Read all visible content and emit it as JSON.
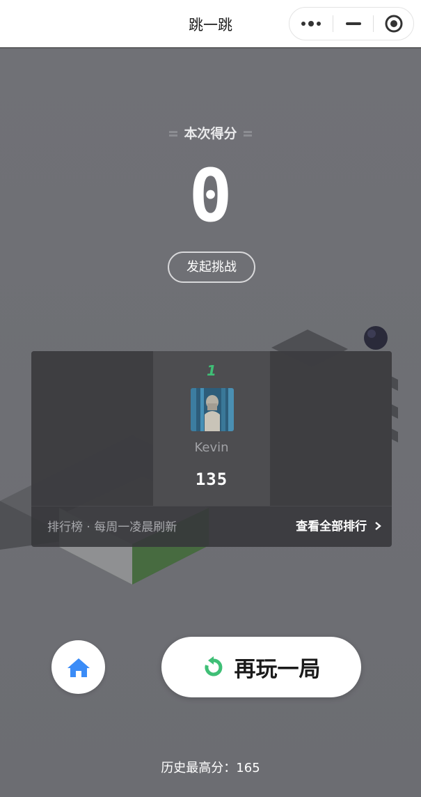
{
  "window": {
    "title": "跳一跳"
  },
  "capsule": {
    "menu_icon": "more-dots-icon",
    "minimize_icon": "minus-icon",
    "close_icon": "target-circle-icon"
  },
  "result": {
    "score_label": "本次得分",
    "score": "0",
    "challenge_label": "发起挑战"
  },
  "leaderboard": {
    "entries": [
      {
        "rank": "1",
        "name": "Kevin",
        "score": "135",
        "avatar_icon": "user-avatar-photo"
      }
    ],
    "footer_left": "排行榜 · 每周一凌晨刷新",
    "footer_right": "查看全部排行",
    "footer_right_icon": "chevron-right-icon"
  },
  "actions": {
    "home_icon": "home-icon",
    "replay_icon": "refresh-icon",
    "replay_label": "再玩一局"
  },
  "best": {
    "text": "历史最高分：165"
  },
  "colors": {
    "accent_green": "#3fbf76",
    "home_blue": "#3b8cf7",
    "background": "#6f7075"
  }
}
